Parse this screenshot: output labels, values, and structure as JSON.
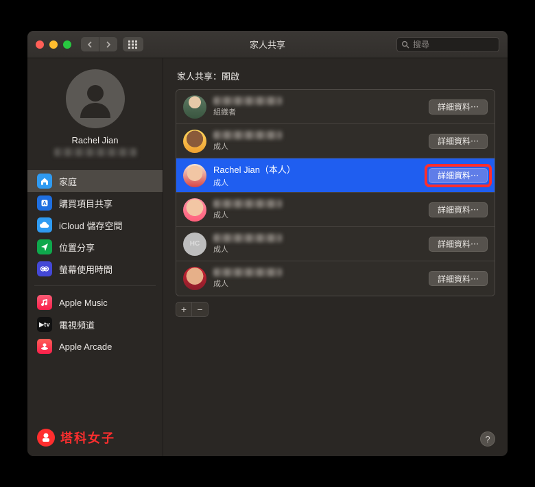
{
  "window": {
    "title": "家人共享",
    "search_placeholder": "搜尋"
  },
  "profile": {
    "name": "Rachel Jian"
  },
  "sidebar": {
    "groups": [
      [
        {
          "id": "home",
          "label": "家庭",
          "icon": "home",
          "selected": true
        },
        {
          "id": "purch",
          "label": "購買項目共享",
          "icon": "app",
          "selected": false
        },
        {
          "id": "icloud",
          "label": "iCloud 儲存空間",
          "icon": "cloud",
          "selected": false
        },
        {
          "id": "loc",
          "label": "位置分享",
          "icon": "loc",
          "selected": false
        },
        {
          "id": "screen",
          "label": "螢幕使用時間",
          "icon": "screen",
          "selected": false
        }
      ],
      [
        {
          "id": "music",
          "label": "Apple Music",
          "icon": "music",
          "selected": false
        },
        {
          "id": "tv",
          "label": "電視頻道",
          "icon": "tv",
          "selected": false
        },
        {
          "id": "arcade",
          "label": "Apple Arcade",
          "icon": "arcade",
          "selected": false
        }
      ]
    ]
  },
  "main": {
    "heading": "家人共享：開啟",
    "details_label": "詳細資料⋯",
    "add_label": "+",
    "remove_label": "−",
    "help_label": "?",
    "members": [
      {
        "name": "",
        "name_hidden": true,
        "role": "組織者",
        "avatar": "av-1",
        "selected": false,
        "highlight": false
      },
      {
        "name": "",
        "name_hidden": true,
        "role": "成人",
        "avatar": "av-2",
        "selected": false,
        "highlight": false
      },
      {
        "name": "Rachel Jian（本人）",
        "name_hidden": false,
        "role": "成人",
        "avatar": "av-3",
        "selected": true,
        "highlight": true
      },
      {
        "name": "",
        "name_hidden": true,
        "role": "成人",
        "avatar": "av-4",
        "selected": false,
        "highlight": false
      },
      {
        "name": "",
        "name_hidden": true,
        "role": "成人",
        "avatar": "av-5",
        "avatar_text": "HC",
        "selected": false,
        "highlight": false
      },
      {
        "name": "",
        "name_hidden": true,
        "role": "成人",
        "avatar": "av-6",
        "selected": false,
        "highlight": false
      }
    ]
  },
  "watermark": {
    "text": "塔科女子"
  }
}
